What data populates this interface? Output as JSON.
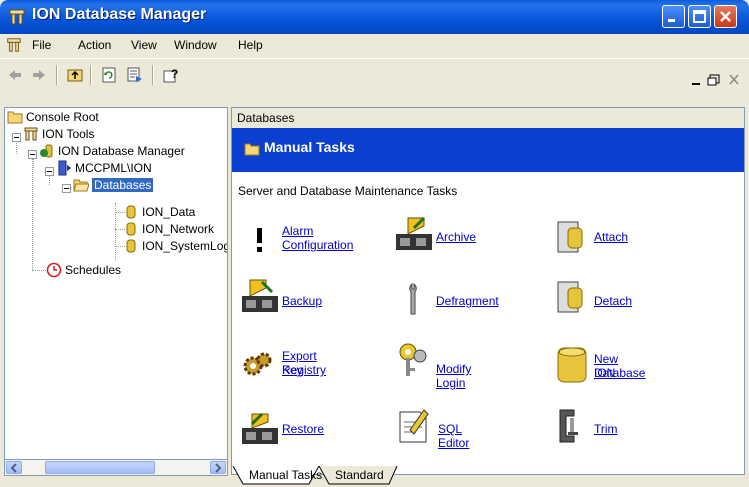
{
  "window": {
    "title": "ION Database Manager"
  },
  "menubar": {
    "items": [
      "File",
      "Action",
      "View",
      "Window",
      "Help"
    ]
  },
  "tree": {
    "nodes": [
      "Console Root",
      "ION Tools",
      "ION Database Manager",
      "MCCPML\\ION",
      "Databases",
      "ION_Data",
      "ION_Network",
      "ION_SystemLog",
      "Schedules"
    ],
    "selected": "Databases"
  },
  "right": {
    "header": "Databases",
    "banner_title": "Manual Tasks",
    "section_label": "Server and Database Maintenance Tasks",
    "tasks": [
      {
        "label1": "Alarm",
        "label2": "Configuration",
        "icon": "exclamation-icon"
      },
      {
        "label1": "Archive",
        "label2": "",
        "icon": "archive-icon"
      },
      {
        "label1": "Attach",
        "label2": "",
        "icon": "attach-icon"
      },
      {
        "label1": "Backup",
        "label2": "",
        "icon": "backup-icon"
      },
      {
        "label1": "Defragment",
        "label2": "",
        "icon": "wrench-icon"
      },
      {
        "label1": "Detach",
        "label2": "",
        "icon": "detach-icon"
      },
      {
        "label1": "Export Registry",
        "label2": "Key",
        "icon": "gears-icon"
      },
      {
        "label1": "Modify Login",
        "label2": "",
        "icon": "keys-icon"
      },
      {
        "label1": "New ION",
        "label2": "Database",
        "icon": "database-cylinder-icon"
      },
      {
        "label1": "Restore",
        "label2": "",
        "icon": "restore-icon"
      },
      {
        "label1": "SQL Editor",
        "label2": "",
        "icon": "sql-editor-icon"
      },
      {
        "label1": "Trim",
        "label2": "",
        "icon": "clamp-icon"
      }
    ]
  },
  "tabs": [
    "Manual Tasks",
    "Standard"
  ],
  "colors": {
    "title_bar": "#0754d8",
    "banner": "#0a3fcf",
    "link": "#0000cc",
    "selection": "#316ac5"
  }
}
